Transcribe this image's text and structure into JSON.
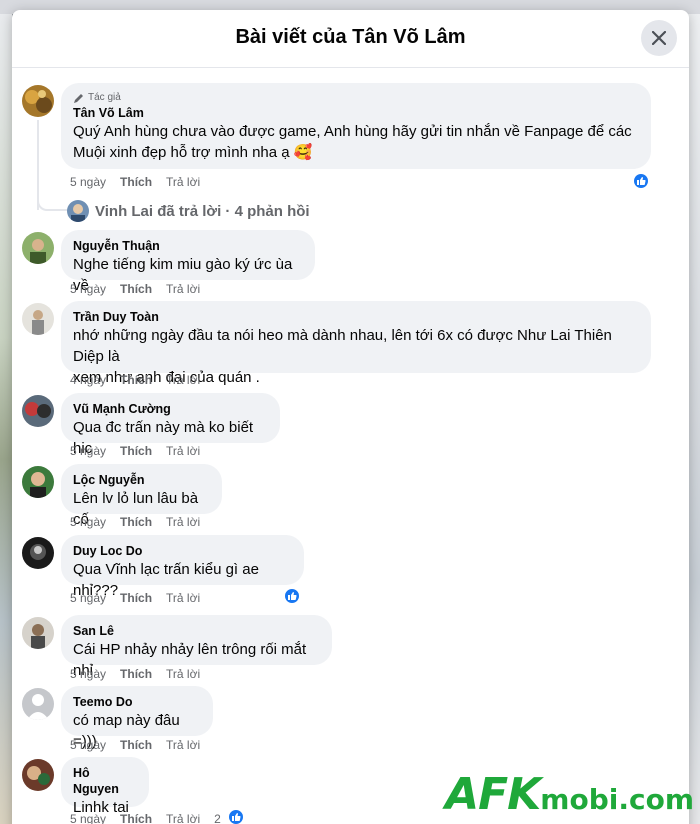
{
  "dialog": {
    "title": "Bài viết của Tân Võ Lâm"
  },
  "comments": [
    {
      "badge": "Tác giả",
      "author": "Tân Võ Lâm",
      "lines": [
        "Quý Anh hùng chưa vào được game, Anh hùng hãy gửi tin nhắn về Fanpage để các",
        "Muội xinh đẹp hỗ trợ mình nha ạ 🥰"
      ],
      "time": "5 ngày",
      "like": "Thích",
      "reply": "Trả lời"
    },
    {
      "author": "Nguyễn Thuận",
      "lines": [
        "Nghe tiếng kim miu gào ký ức ùa về"
      ],
      "time": "5 ngày",
      "like": "Thích",
      "reply": "Trả lời"
    },
    {
      "author": "Trần Duy Toàn",
      "lines": [
        "nhớ những ngày đầu ta nói heo mà dành nhau, lên tới 6x có được Như Lai Thiên Diệp là",
        "xem như anh đại của quán ."
      ],
      "time": "4 ngày",
      "like": "Thích",
      "reply": "Trả lời"
    },
    {
      "author": "Vũ Mạnh Cường",
      "lines": [
        "Qua đc trấn này mà ko biết hic"
      ],
      "time": "5 ngày",
      "like": "Thích",
      "reply": "Trả lời"
    },
    {
      "author": "Lộc Nguyễn",
      "lines": [
        "Lên lv lỏ lun lâu bà cố"
      ],
      "time": "5 ngày",
      "like": "Thích",
      "reply": "Trả lời"
    },
    {
      "author": "Duy Loc Do",
      "lines": [
        "Qua Vĩnh lạc trấn kiểu gì ae nhỉ???"
      ],
      "time": "5 ngày",
      "like": "Thích",
      "reply": "Trả lời"
    },
    {
      "author": "San Lê",
      "lines": [
        "Cái HP nhảy nhảy lên trông rối mắt nhỉ"
      ],
      "time": "5 ngày",
      "like": "Thích",
      "reply": "Trả lời"
    },
    {
      "author": "Teemo Do",
      "lines": [
        "có map này đâu =)))"
      ],
      "time": "5 ngày",
      "like": "Thích",
      "reply": "Trả lời"
    },
    {
      "author": "Hô Nguyen",
      "lines": [
        "Linhk tai"
      ],
      "time": "5 ngày",
      "like": "Thích",
      "reply": "Trả lời",
      "reaction_count": "2"
    }
  ],
  "reply_summary": "Vinh Lai đã trả lời · 4 phản hồi",
  "watermark": {
    "part1": "AFK",
    "part2": "mobi",
    "part3": ".com"
  },
  "colors": {
    "accent": "#1877f2",
    "bubble": "#f0f2f5",
    "watermark_green": "#1fa83a"
  }
}
